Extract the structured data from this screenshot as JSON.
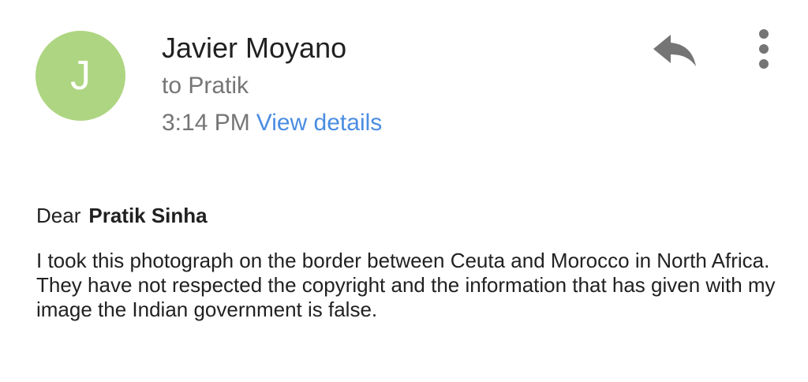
{
  "sender": {
    "initial": "J",
    "name": "Javier Moyano",
    "avatar_color": "#aed581"
  },
  "recipient_line": "to Pratik",
  "time": "3:14 PM",
  "view_details_label": "View details",
  "icons": {
    "reply": "reply-icon",
    "more": "more-vertical-icon"
  },
  "message": {
    "greeting_prefix": "Dear",
    "greeting_name": "Pratik Sinha",
    "line1": "I took this photograph on the border between Ceuta and Morocco in North Africa.",
    "line2": "They have not respected the copyright and the information that has given with my image the Indian government is false."
  }
}
